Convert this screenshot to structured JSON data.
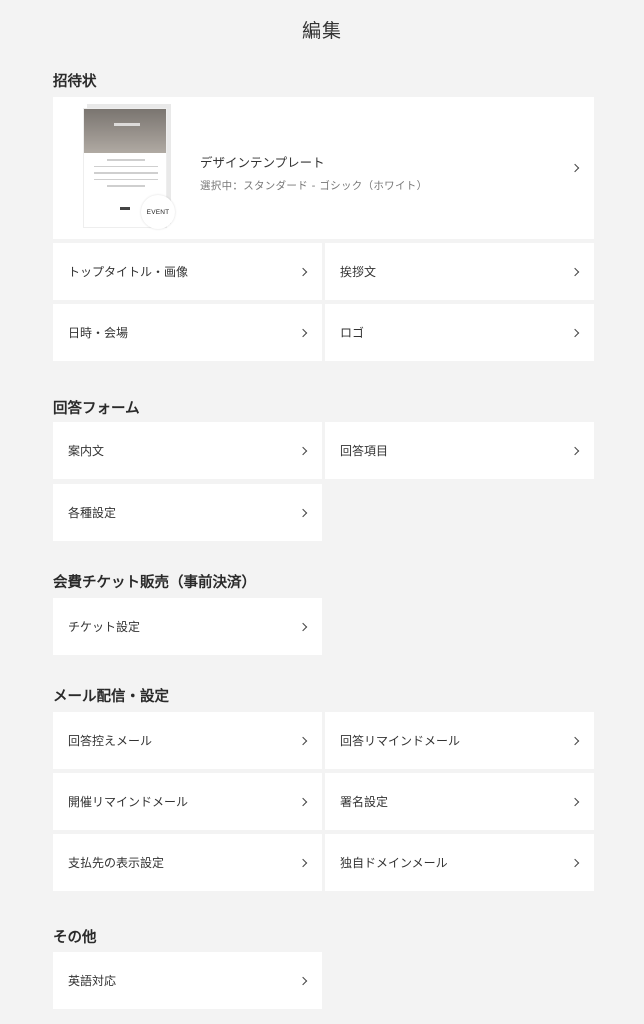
{
  "page_title": "編集",
  "sections": {
    "invitation": "招待状",
    "form": "回答フォーム",
    "ticket": "会費チケット販売（事前決済）",
    "mail": "メール配信・設定",
    "other": "その他"
  },
  "template": {
    "name": "デザインテンプレート",
    "selected": "選択中：スタンダード - ゴシック（ホワイト）",
    "badge": "EVENT"
  },
  "items": {
    "top_title": "トップタイトル・画像",
    "greeting": "挨拶文",
    "datetime": "日時・会場",
    "logo": "ロゴ",
    "guide": "案内文",
    "answer_items": "回答項目",
    "settings": "各種設定",
    "ticket_settings": "チケット設定",
    "confirm_mail": "回答控えメール",
    "answer_remind": "回答リマインドメール",
    "event_remind": "開催リマインドメール",
    "signature": "署名設定",
    "payee": "支払先の表示設定",
    "custom_domain": "独自ドメインメール",
    "english": "英語対応"
  }
}
